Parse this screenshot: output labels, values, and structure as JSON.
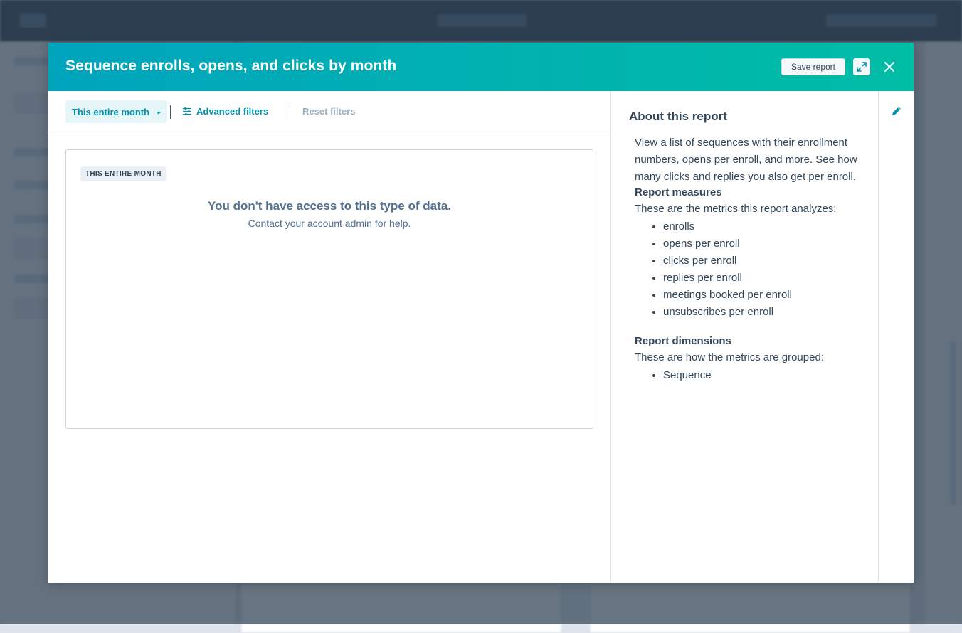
{
  "modal": {
    "title": "Sequence enrolls, opens, and clicks by month",
    "save_label": "Save report"
  },
  "filters": {
    "date_range_label": "This entire month",
    "advanced_label": "Advanced filters",
    "reset_label": "Reset filters"
  },
  "report": {
    "date_tag": "THIS ENTIRE MONTH",
    "no_access_title": "You don't have access to this type of data.",
    "no_access_subtitle": "Contact your account admin for help."
  },
  "about": {
    "title": "About this report",
    "description": "View a list of sequences with their enrollment numbers, opens per enroll, and more. See how many clicks and replies you also get per enroll.",
    "measures_heading": "Report measures",
    "measures_intro": "These are the metrics this report analyzes:",
    "measures": [
      "enrolls",
      "opens per enroll",
      "clicks per enroll",
      "replies per enroll",
      "meetings booked per enroll",
      "unsubscribes per enroll"
    ],
    "dimensions_heading": "Report dimensions",
    "dimensions_intro": "These are how the metrics are grouped:",
    "dimensions": [
      "Sequence"
    ]
  },
  "colors": {
    "header_gradient_start": "#00a4bd",
    "header_gradient_end": "#00bda5",
    "accent": "#0091ae",
    "text": "#33475b",
    "muted_text": "#516f90"
  },
  "icons": {
    "expand": "expand-arrows-icon",
    "close": "close-x-icon",
    "caret": "caret-down-icon",
    "filters": "sliders-icon",
    "edit": "pencil-icon"
  }
}
